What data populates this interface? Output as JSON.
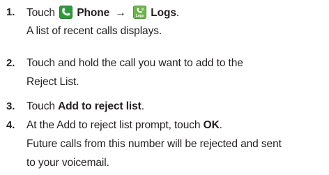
{
  "steps": [
    {
      "number": "1.",
      "parts": {
        "touch": "Touch",
        "phone": "Phone",
        "arrow": "→",
        "logs": "Logs",
        "logs_icon_caption": "Logs",
        "end": "."
      },
      "detail": "A list of recent calls displays."
    },
    {
      "number": "2.",
      "line1": "Touch and hold the call you want to add to the",
      "line2": "Reject List."
    },
    {
      "number": "3.",
      "pre": "Touch ",
      "bold": "Add to reject list",
      "post": "."
    },
    {
      "number": "4.",
      "pre": "At the Add to reject list prompt, touch ",
      "bold": "OK",
      "post": ".",
      "detail_line1": "Future calls from this number will be rejected and sent",
      "detail_line2": "to your voicemail."
    }
  ],
  "icons": {
    "phone": "phone-app-icon",
    "logs": "logs-app-icon",
    "phone_color": "#2e9b3a",
    "logs_color": "#6bb64a"
  }
}
